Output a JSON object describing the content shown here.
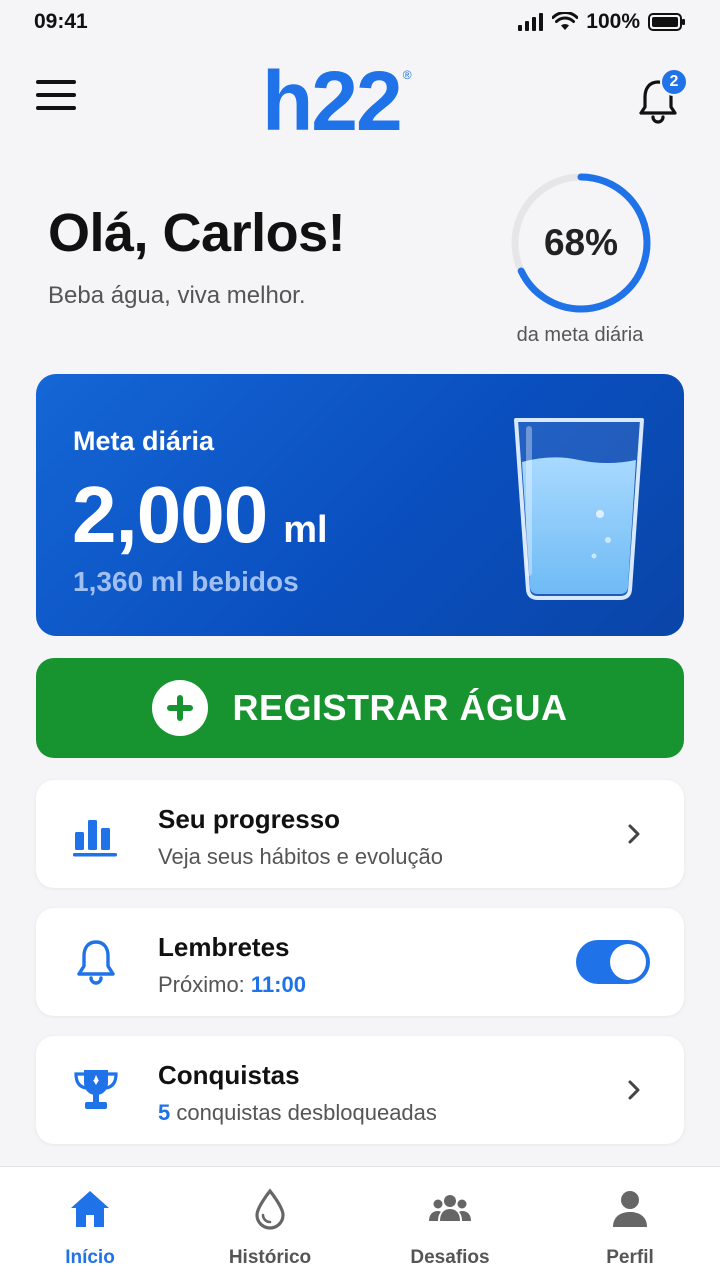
{
  "status_bar": {
    "time": "09:41",
    "battery": "100%"
  },
  "header": {
    "logo": "h22",
    "logo_mark": "®",
    "notifications_count": "2"
  },
  "greeting": {
    "title": "Olá, Carlos!",
    "subtitle": "Beba água, viva melhor."
  },
  "progress": {
    "percent_label": "68%",
    "percent_value": 68,
    "caption": "da meta diária"
  },
  "goal_card": {
    "label": "Meta diária",
    "value": "2,000",
    "unit": "ml",
    "drunk": "1,360 ml bebidos"
  },
  "register_button": {
    "label": "REGISTRAR ÁGUA"
  },
  "cards": {
    "progress": {
      "title": "Seu progresso",
      "subtitle": "Veja seus hábitos e evolução",
      "icon": "bar-chart-icon"
    },
    "reminders": {
      "title": "Lembretes",
      "subtitle_prefix": "Próximo:",
      "next_time": "11:00",
      "enabled": true,
      "icon": "bell-icon"
    },
    "achievements": {
      "title": "Conquistas",
      "count": "5",
      "subtitle_suffix": "conquistas desbloqueadas",
      "icon": "trophy-icon"
    }
  },
  "tabs": [
    {
      "label": "Início",
      "icon": "home-icon",
      "active": true
    },
    {
      "label": "Histórico",
      "icon": "drop-icon",
      "active": false
    },
    {
      "label": "Desafios",
      "icon": "group-icon",
      "active": false
    },
    {
      "label": "Perfil",
      "icon": "person-icon",
      "active": false
    }
  ],
  "colors": {
    "primary": "#1f72e8",
    "success": "#17942f",
    "card_dark": "#0a4fbf"
  }
}
